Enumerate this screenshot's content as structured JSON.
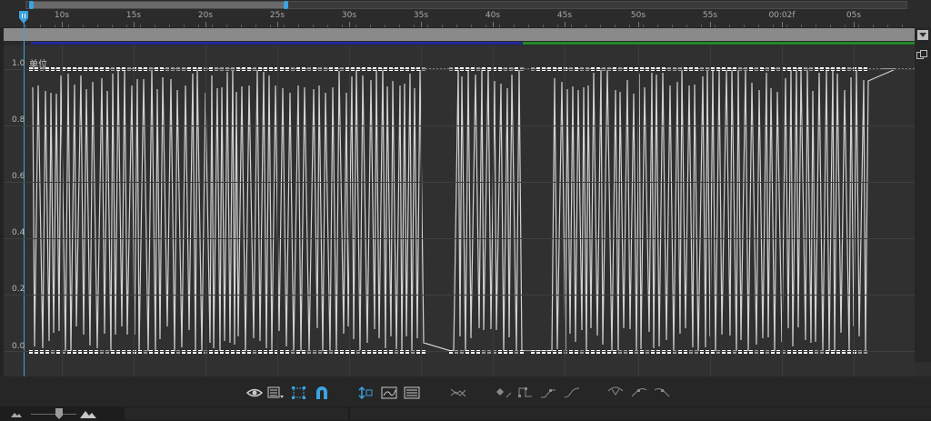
{
  "colors": {
    "accent": "#3aa3e0",
    "curve": "#d2d2d2",
    "work_area_blue": "#1e2a9a",
    "work_area_green": "#1f8a2a",
    "keyframe": "#ffffff"
  },
  "ruler": {
    "ticks": [
      "10s",
      "15s",
      "20s",
      "25s",
      "30s",
      "35s",
      "40s",
      "45s",
      "50s",
      "55s",
      "00:02f",
      "05s"
    ]
  },
  "graph": {
    "unit_label": "单位",
    "y_axis": [
      "1.0",
      "0.8",
      "0.6",
      "0.4",
      "0.2",
      "0.0"
    ]
  },
  "toolbar": {
    "icons": [
      "eye-icon",
      "graph-type-menu-icon",
      "transform-box-icon",
      "snap-icon",
      "fit-selection-icon",
      "fit-all-icon",
      "graph-overlay-icon",
      "separate-dimensions-icon",
      "keyframe-edit-icon",
      "hold-keyframe-icon",
      "linear-keyframe-icon",
      "auto-bezier-icon",
      "easy-ease-icon",
      "easy-ease-in-icon",
      "easy-ease-out-icon"
    ]
  },
  "status_bar": {
    "icons": [
      "small-mountain-icon",
      "zoom-slider",
      "large-mountain-icon"
    ]
  }
}
